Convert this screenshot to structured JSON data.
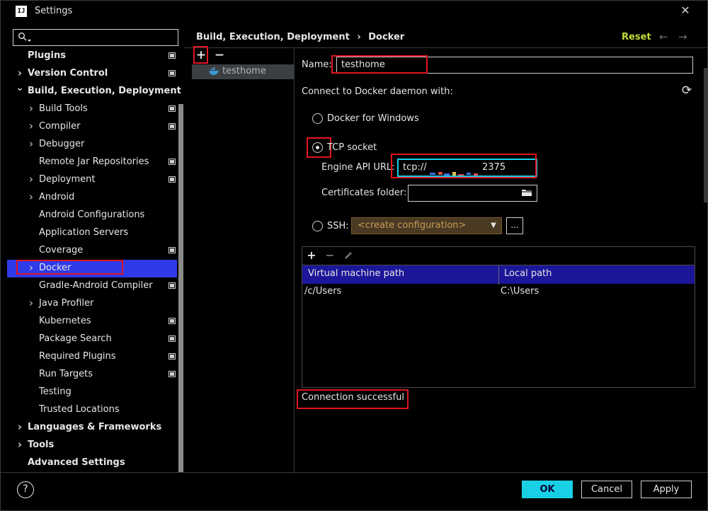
{
  "window": {
    "title": "Settings",
    "logo_text": "IJ"
  },
  "search": {
    "placeholder": ""
  },
  "sidebar": {
    "items": [
      {
        "label": "Plugins",
        "bold": true,
        "chevron": false,
        "indent": 0,
        "project_icon": true
      },
      {
        "label": "Version Control",
        "bold": true,
        "chevron": "right",
        "indent": 0,
        "project_icon": true
      },
      {
        "label": "Build, Execution, Deployment",
        "bold": true,
        "chevron": "down",
        "indent": 0,
        "project_icon": false
      },
      {
        "label": "Build Tools",
        "bold": false,
        "chevron": "right",
        "indent": 1,
        "project_icon": true
      },
      {
        "label": "Compiler",
        "bold": false,
        "chevron": "right",
        "indent": 1,
        "project_icon": true
      },
      {
        "label": "Debugger",
        "bold": false,
        "chevron": "right",
        "indent": 1,
        "project_icon": false
      },
      {
        "label": "Remote Jar Repositories",
        "bold": false,
        "chevron": false,
        "indent": 1,
        "project_icon": true
      },
      {
        "label": "Deployment",
        "bold": false,
        "chevron": "right",
        "indent": 1,
        "project_icon": true
      },
      {
        "label": "Android",
        "bold": false,
        "chevron": "right",
        "indent": 1,
        "project_icon": false
      },
      {
        "label": "Android Configurations",
        "bold": false,
        "chevron": false,
        "indent": 1,
        "project_icon": false
      },
      {
        "label": "Application Servers",
        "bold": false,
        "chevron": false,
        "indent": 1,
        "project_icon": false
      },
      {
        "label": "Coverage",
        "bold": false,
        "chevron": false,
        "indent": 1,
        "project_icon": true
      },
      {
        "label": "Docker",
        "bold": false,
        "chevron": "right",
        "indent": 1,
        "project_icon": false,
        "selected": true
      },
      {
        "label": "Gradle-Android Compiler",
        "bold": false,
        "chevron": false,
        "indent": 1,
        "project_icon": true
      },
      {
        "label": "Java Profiler",
        "bold": false,
        "chevron": "right",
        "indent": 1,
        "project_icon": false
      },
      {
        "label": "Kubernetes",
        "bold": false,
        "chevron": false,
        "indent": 1,
        "project_icon": true
      },
      {
        "label": "Package Search",
        "bold": false,
        "chevron": false,
        "indent": 1,
        "project_icon": true
      },
      {
        "label": "Required Plugins",
        "bold": false,
        "chevron": false,
        "indent": 1,
        "project_icon": true
      },
      {
        "label": "Run Targets",
        "bold": false,
        "chevron": false,
        "indent": 1,
        "project_icon": true
      },
      {
        "label": "Testing",
        "bold": false,
        "chevron": false,
        "indent": 1,
        "project_icon": false
      },
      {
        "label": "Trusted Locations",
        "bold": false,
        "chevron": false,
        "indent": 1,
        "project_icon": false
      },
      {
        "label": "Languages & Frameworks",
        "bold": true,
        "chevron": "right",
        "indent": 0,
        "project_icon": false
      },
      {
        "label": "Tools",
        "bold": true,
        "chevron": "right",
        "indent": 0,
        "project_icon": false
      },
      {
        "label": "Advanced Settings",
        "bold": true,
        "chevron": false,
        "indent": 0,
        "project_icon": false
      }
    ]
  },
  "header": {
    "breadcrumb_parent": "Build, Execution, Deployment",
    "breadcrumb_sep": "›",
    "breadcrumb_current": "Docker",
    "reset_label": "Reset",
    "back_arrow": "←",
    "forward_arrow": "→"
  },
  "docker_list": {
    "add_glyph": "+",
    "remove_glyph": "−",
    "items": [
      "testhome"
    ]
  },
  "form": {
    "name_label": "Name:",
    "name_value": "testhome",
    "connect_label": "Connect to Docker daemon with:",
    "refresh_glyph": "⟳",
    "option_windows": "Docker for Windows",
    "option_tcp": "TCP socket",
    "engine_api_label": "Engine API URL:",
    "engine_api_prefix": "tcp://",
    "engine_api_suffix": "2375",
    "certs_label": "Certificates folder:",
    "certs_value": "",
    "option_ssh": "SSH:",
    "ssh_combo_value": "<create configuration>",
    "ssh_more_label": "..."
  },
  "mappings": {
    "columns": [
      "Virtual machine path",
      "Local path"
    ],
    "rows": [
      {
        "vm": "/c/Users",
        "local": "C:\\Users"
      }
    ]
  },
  "status": {
    "text": "Connection successful"
  },
  "footer": {
    "help_label": "?",
    "ok_label": "OK",
    "cancel_label": "Cancel",
    "apply_label": "Apply"
  },
  "colors": {
    "accent_selection": "#2f3ae8",
    "table_header": "#1c1699",
    "ok_button": "#18d0e6",
    "reset_link": "#c3dc3c",
    "highlight_box": "#e0151f"
  }
}
